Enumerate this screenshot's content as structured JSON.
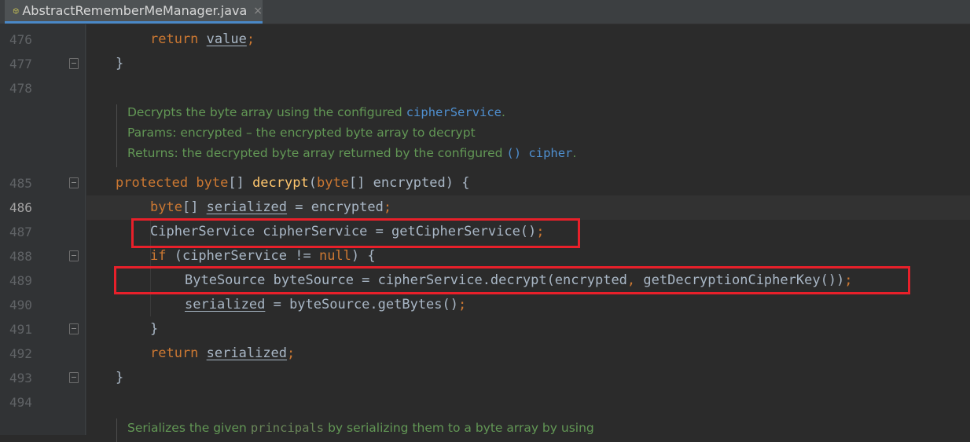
{
  "tab": {
    "title": "AbstractRememberMeManager.java",
    "close_glyph": "×",
    "icon": "java-class-icon"
  },
  "gutter": {
    "line_numbers": [
      "476",
      "477",
      "478",
      "485",
      "486",
      "487",
      "488",
      "489",
      "490",
      "491",
      "492",
      "493",
      "494"
    ]
  },
  "doc": {
    "line1_text": "Decrypts the byte array using the configured ",
    "line1_code": "cipherService",
    "line1_end": ".",
    "line2": "Params: encrypted – the encrypted byte array to decrypt",
    "line3_text": "Returns: the decrypted byte array returned by the configured ",
    "line3_code": "() cipher",
    "line3_end": ".",
    "line4_text": "Serializes the given ",
    "line4_code": "principals",
    "line4_end": " by serializing them to a byte array by using"
  },
  "code": {
    "l476": {
      "kw": "return",
      "var": "value",
      "semi": ";"
    },
    "l477": {
      "brace": "}"
    },
    "l485": {
      "kw1": "protected",
      "kw2": "byte",
      "brackets": "[]",
      "fn": "decrypt",
      "p1": "(",
      "kw3": "byte",
      "rest": "[] encrypted) {"
    },
    "l486": {
      "kw": "byte",
      "brackets": "[] ",
      "var": "serialized",
      "rest": " = encrypted",
      "semi": ";"
    },
    "l487": {
      "text": "CipherService cipherService = getCipherService()",
      "semi": ";"
    },
    "l488": {
      "kw": "if",
      "mid": " (cipherService != ",
      "kw2": "null",
      "end": ") {"
    },
    "l489": {
      "text1": "ByteSource byteSource = cipherService.decrypt(encrypted",
      "comma": ",",
      "text2": " getDecryptionCipherKey())",
      "semi": ";"
    },
    "l490": {
      "var": "serialized",
      "rest": " = byteSource.getBytes()",
      "semi": ";"
    },
    "l491": {
      "brace": "}"
    },
    "l492": {
      "kw": "return",
      "var": "serialized",
      "semi": ";"
    },
    "l493": {
      "brace": "}"
    }
  },
  "colors": {
    "highlight_box": "#e8202a",
    "keyword": "#cc7832",
    "function": "#ffc66d",
    "doc_comment": "#629755"
  }
}
